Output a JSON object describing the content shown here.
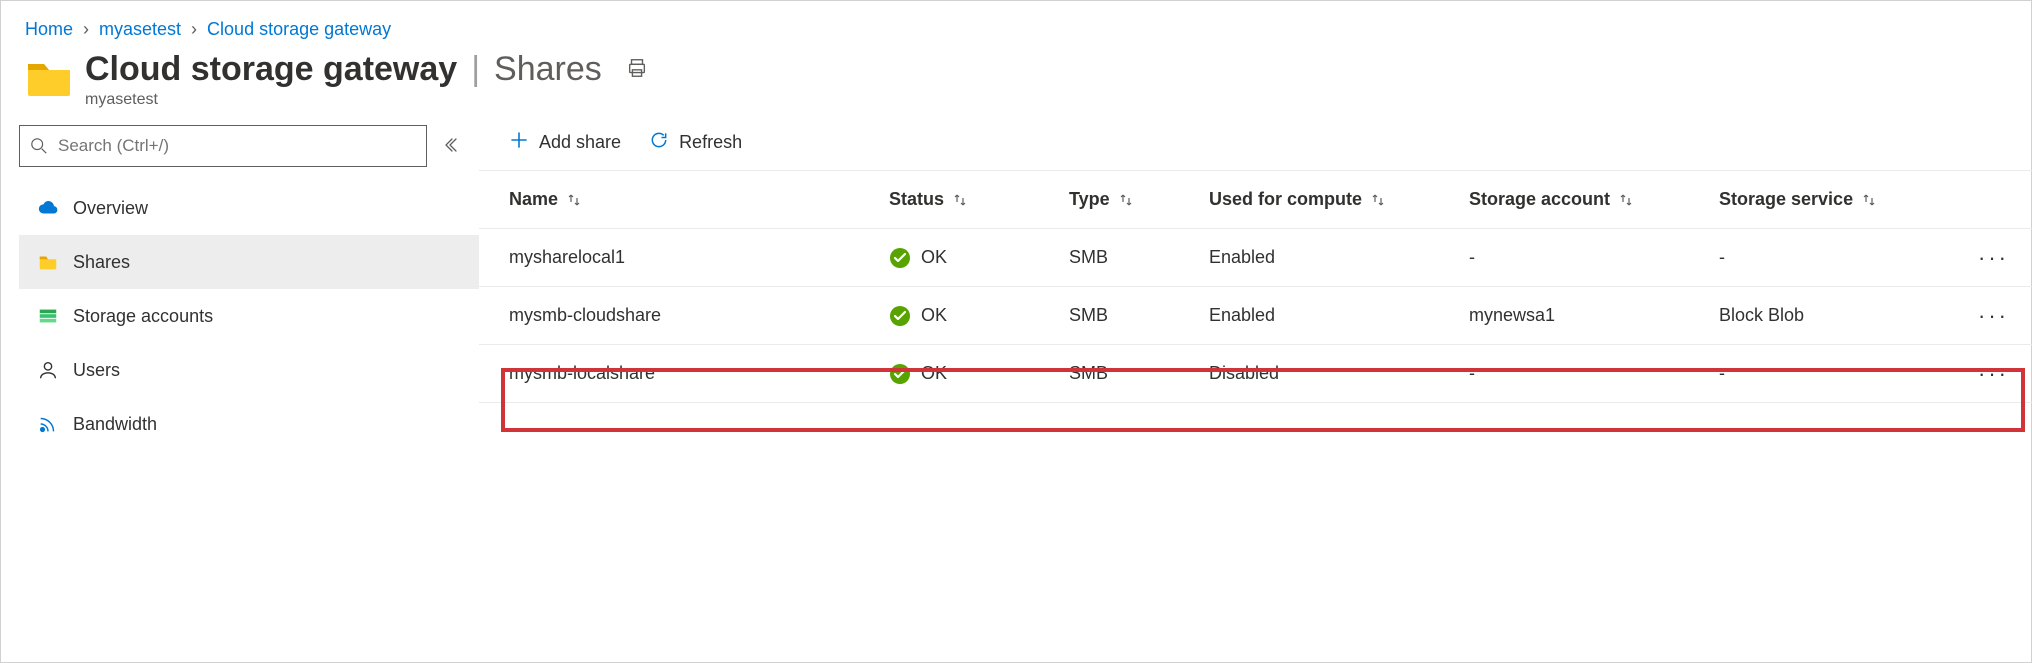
{
  "breadcrumb": {
    "items": [
      "Home",
      "myasetest",
      "Cloud storage gateway"
    ]
  },
  "header": {
    "title": "Cloud storage gateway",
    "section": "Shares",
    "subtitle": "myasetest"
  },
  "search": {
    "placeholder": "Search (Ctrl+/)"
  },
  "sidebar": {
    "items": [
      {
        "label": "Overview",
        "icon": "cloud-icon"
      },
      {
        "label": "Shares",
        "icon": "folder-icon",
        "selected": true
      },
      {
        "label": "Storage accounts",
        "icon": "storage-icon"
      },
      {
        "label": "Users",
        "icon": "person-icon"
      },
      {
        "label": "Bandwidth",
        "icon": "wifi-icon"
      }
    ]
  },
  "toolbar": {
    "add": "Add share",
    "refresh": "Refresh"
  },
  "table": {
    "columns": [
      "Name",
      "Status",
      "Type",
      "Used for compute",
      "Storage account",
      "Storage service"
    ],
    "rows": [
      {
        "name": "mysharelocal1",
        "status": "OK",
        "type": "SMB",
        "compute": "Enabled",
        "account": "-",
        "service": "-"
      },
      {
        "name": "mysmb-cloudshare",
        "status": "OK",
        "type": "SMB",
        "compute": "Enabled",
        "account": "mynewsa1",
        "service": "Block Blob",
        "highlighted": true
      },
      {
        "name": "mysmb-localshare",
        "status": "OK",
        "type": "SMB",
        "compute": "Disabled",
        "account": "-",
        "service": "-"
      }
    ]
  }
}
